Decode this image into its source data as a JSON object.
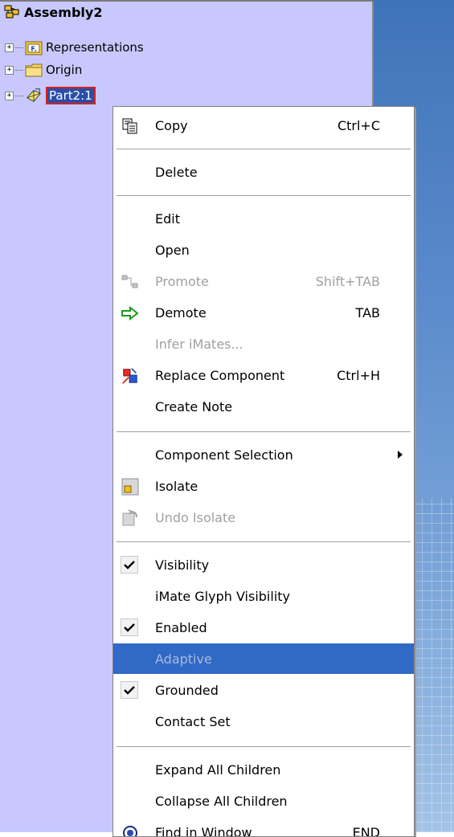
{
  "tree": {
    "root": "Assembly2",
    "items": [
      {
        "label": "Representations",
        "expander": "+"
      },
      {
        "label": "Origin",
        "expander": "+"
      },
      {
        "label": "Part2:1",
        "expander": "+"
      }
    ]
  },
  "menu": {
    "copy": {
      "label": "Copy",
      "shortcut": "Ctrl+C"
    },
    "delete": {
      "label": "Delete"
    },
    "edit": {
      "label": "Edit"
    },
    "open": {
      "label": "Open"
    },
    "promote": {
      "label": "Promote",
      "shortcut": "Shift+TAB"
    },
    "demote": {
      "label": "Demote",
      "shortcut": "TAB"
    },
    "infer_imates": {
      "label": "Infer iMates..."
    },
    "replace_component": {
      "label": "Replace Component",
      "shortcut": "Ctrl+H"
    },
    "create_note": {
      "label": "Create Note"
    },
    "component_selection": {
      "label": "Component Selection"
    },
    "isolate": {
      "label": "Isolate"
    },
    "undo_isolate": {
      "label": "Undo Isolate"
    },
    "visibility": {
      "label": "Visibility"
    },
    "imate_glyph_visibility": {
      "label": "iMate Glyph Visibility"
    },
    "enabled": {
      "label": "Enabled"
    },
    "adaptive": {
      "label": "Adaptive"
    },
    "grounded": {
      "label": "Grounded"
    },
    "contact_set": {
      "label": "Contact Set"
    },
    "expand_all_children": {
      "label": "Expand All Children"
    },
    "collapse_all_children": {
      "label": "Collapse All Children"
    },
    "find_in_window": {
      "label": "Find in Window",
      "shortcut": "END"
    }
  },
  "colors": {
    "browser_bg": "#c8c8ff",
    "menu_highlight": "#3169c6",
    "selection_border": "#d32020"
  }
}
